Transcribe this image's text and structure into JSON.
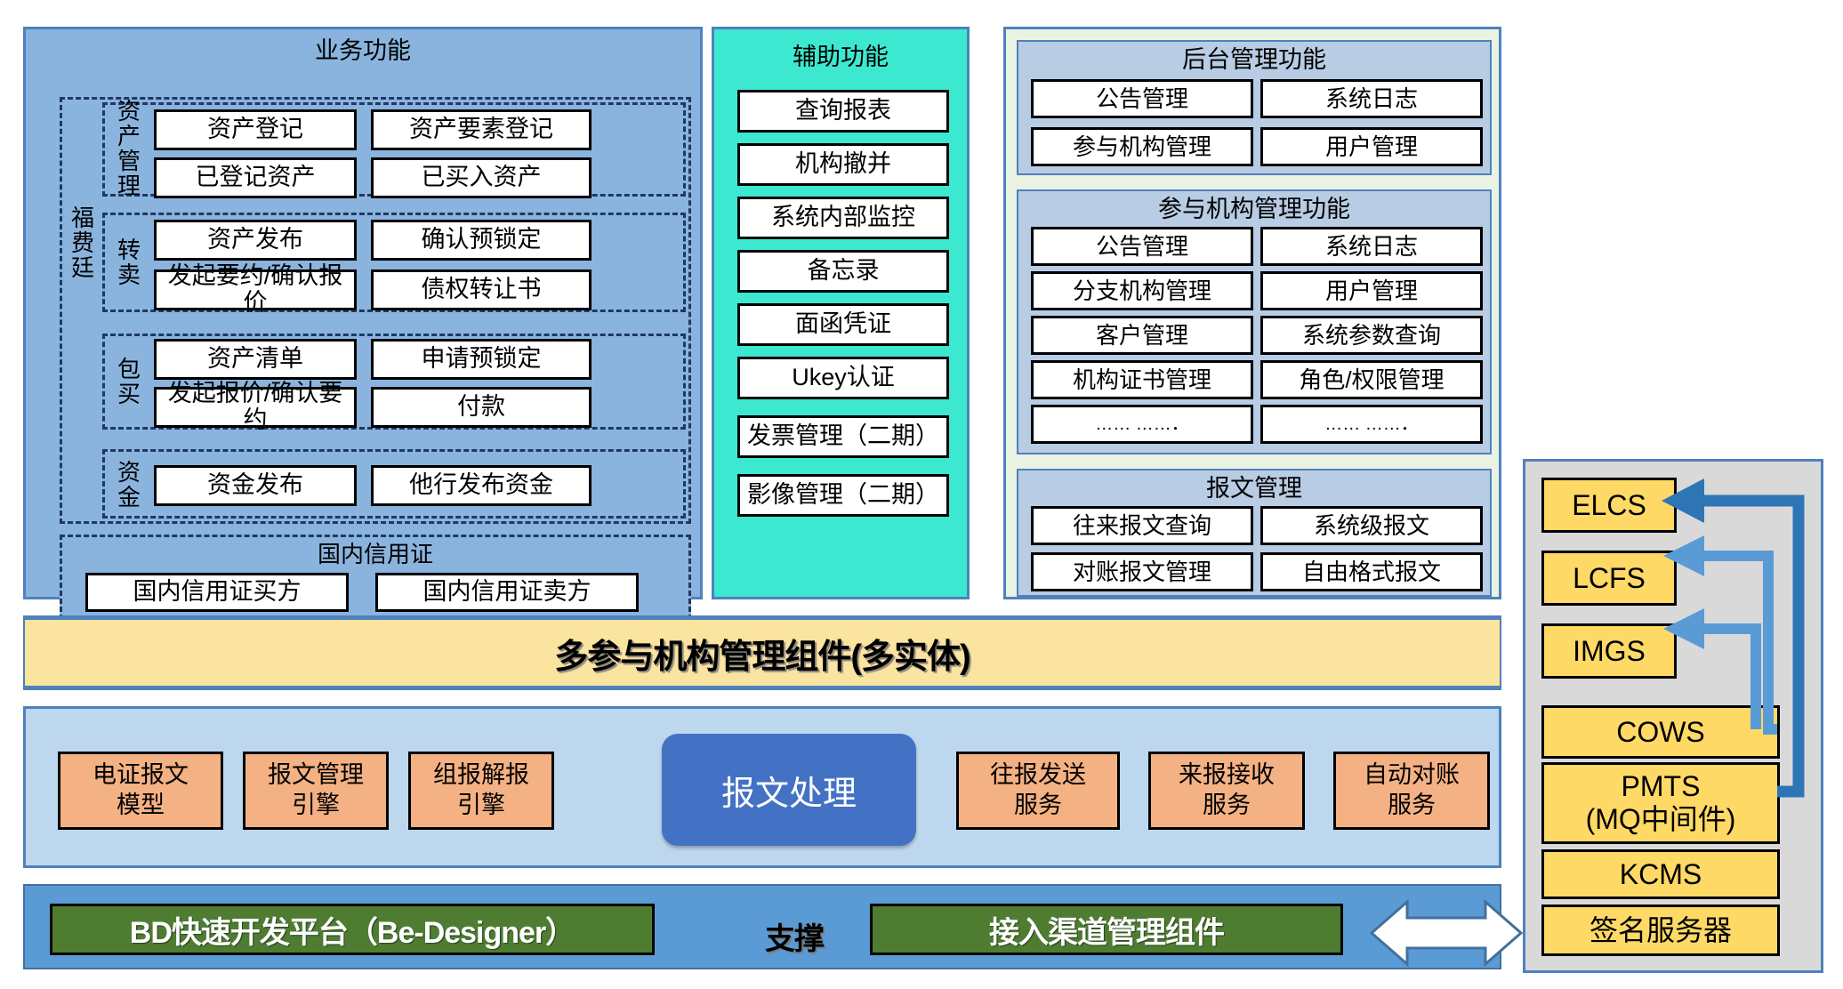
{
  "business": {
    "title": "业务功能",
    "group_label": "福费廷",
    "sections": [
      {
        "label": "资产管理",
        "items": [
          "资产登记",
          "资产要素登记",
          "已登记资产",
          "已买入资产"
        ]
      },
      {
        "label": "转卖",
        "items": [
          "资产发布",
          "确认预锁定",
          "发起要约/确认报价",
          "债权转让书"
        ]
      },
      {
        "label": "包买",
        "items": [
          "资产清单",
          "申请预锁定",
          "发起报价/确认要约",
          "付款"
        ]
      },
      {
        "label": "资金",
        "items": [
          "资金发布",
          "他行发布资金"
        ]
      }
    ],
    "domestic_lc": {
      "title": "国内信用证",
      "items": [
        "国内信用证买方",
        "国内信用证卖方"
      ]
    }
  },
  "aux": {
    "title": "辅助功能",
    "items": [
      "查询报表",
      "机构撤并",
      "系统内部监控",
      "备忘录",
      "面函凭证",
      "Ukey认证",
      "发票管理（二期）",
      "影像管理（二期）"
    ]
  },
  "admin": {
    "backoffice": {
      "title": "后台管理功能",
      "items": [
        "公告管理",
        "系统日志",
        "参与机构管理",
        "用户管理"
      ]
    },
    "institution": {
      "title": "参与机构管理功能",
      "items": [
        "公告管理",
        "系统日志",
        "分支机构管理",
        "用户管理",
        "客户管理",
        "系统参数查询",
        "机构证书管理",
        "角色/权限管理",
        "…… ……．",
        "…… ……．"
      ]
    },
    "message": {
      "title": "报文管理",
      "items": [
        "往来报文查询",
        "系统级报文",
        "对账报文管理",
        "自由格式报文"
      ]
    }
  },
  "component_band": {
    "label": "多参与机构管理组件(多实体)"
  },
  "middle": {
    "left_items": [
      "电证报文\n模型",
      "报文管理\n引擎",
      "组报解报\n引擎"
    ],
    "center": "报文处理",
    "right_items": [
      "往报发送\n服务",
      "来报接收\n服务",
      "自动对账\n服务"
    ]
  },
  "bottom": {
    "platform": "BD快速开发平台（Be-Designer）",
    "support": "支撑",
    "channel": "接入渠道管理组件"
  },
  "stack": {
    "items": [
      "ELCS",
      "LCFS",
      "IMGS",
      "COWS",
      "PMTS\n(MQ中间件)",
      "KCMS",
      "签名服务器"
    ]
  },
  "colors": {
    "business_bg": "#8ab4de",
    "aux_bg": "#3ce8d0",
    "admin_bg": "#eaf3e2",
    "subpanel_bg": "#b8cce4",
    "band_yellow": "#fbe3a0",
    "mid_blue": "#bdd7ee",
    "orange": "#f4b183",
    "msgproc_blue": "#4372c4",
    "bottom_blue": "#5b9bd5",
    "green": "#4e7d32",
    "stack_gray": "#d9d9d9",
    "stack_yellow": "#ffd966",
    "arrow_dark": "#2e75b6",
    "arrow_light": "#5b9bd5"
  }
}
